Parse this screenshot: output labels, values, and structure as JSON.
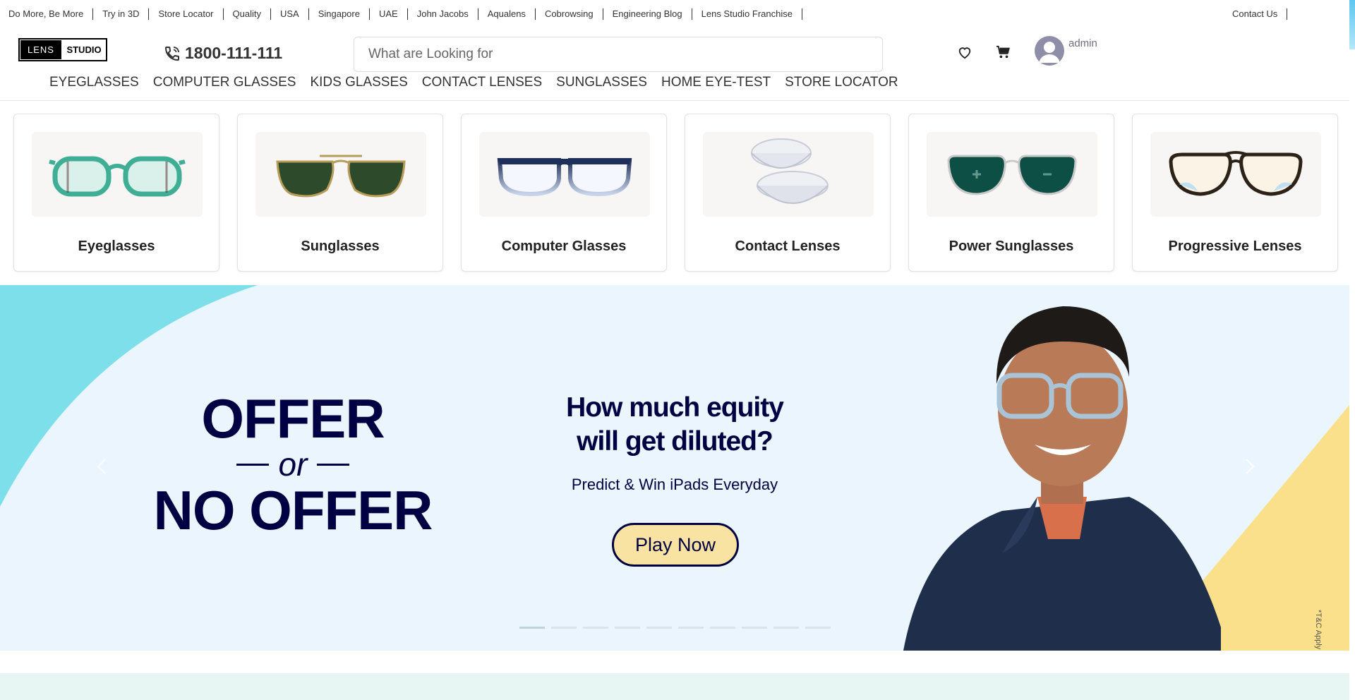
{
  "topbar": {
    "links": [
      "Do More, Be More",
      "Try in 3D",
      "Store Locator",
      "Quality",
      "USA",
      "Singapore",
      "UAE",
      "John Jacobs",
      "Aqualens",
      "Cobrowsing",
      "Engineering Blog",
      "Lens Studio Franchise"
    ],
    "contact": "Contact Us"
  },
  "header": {
    "logo_left": "LENS",
    "logo_right": "STUDIO",
    "phone": "1800-111-111",
    "search_placeholder": "What are Looking for",
    "user_name": "admin"
  },
  "nav": [
    "EYEGLASSES",
    "COMPUTER GLASSES",
    "KIDS GLASSES",
    "CONTACT LENSES",
    "SUNGLASSES",
    "HOME EYE-TEST",
    "STORE LOCATOR"
  ],
  "categories": [
    {
      "label": "Eyeglasses",
      "icon": "eyeglasses-image"
    },
    {
      "label": "Sunglasses",
      "icon": "sunglasses-image"
    },
    {
      "label": "Computer Glasses",
      "icon": "computer-glasses-image"
    },
    {
      "label": "Contact Lenses",
      "icon": "contact-lenses-image"
    },
    {
      "label": "Power Sunglasses",
      "icon": "power-sunglasses-image"
    },
    {
      "label": "Progressive Lenses",
      "icon": "progressive-lenses-image"
    }
  ],
  "banner": {
    "offer_line1": "OFFER",
    "offer_or": "or",
    "offer_line2": "NO OFFER",
    "question": "How much equity will get diluted?",
    "subtitle": "Predict & Win iPads Everyday",
    "cta": "Play Now",
    "tnc": "*T&C Apply",
    "slide_count": 10,
    "active_slide": 1
  },
  "colors": {
    "navy": "#000042",
    "banner_bg": "#eaf5fd",
    "cyan": "#7ddfea",
    "yellow": "#fbe08c",
    "cta_fill": "#f8e3a2"
  }
}
